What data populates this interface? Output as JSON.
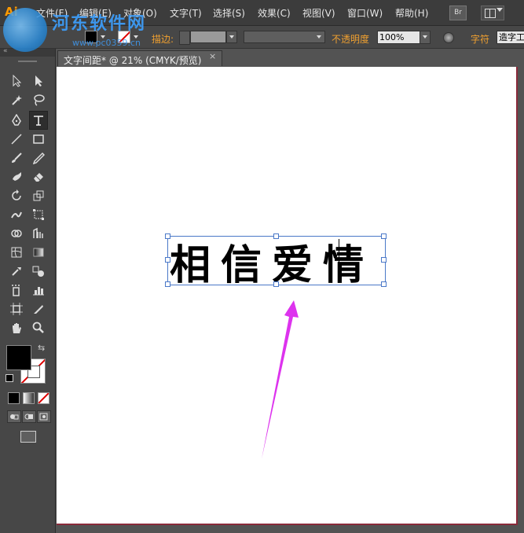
{
  "app": {
    "logo_text": "Ai",
    "watermark_text": "河东软件网",
    "watermark_url": "www.pc0359.cn"
  },
  "menu": {
    "items": [
      "文件(F)",
      "编辑(E)",
      "对象(O)",
      "文字(T)",
      "选择(S)",
      "效果(C)",
      "视图(V)",
      "窗口(W)",
      "帮助(H)"
    ],
    "bridge_label": "Br"
  },
  "control_bar": {
    "fill_color": "#000000",
    "stroke_label": "描边:",
    "opacity_label": "不透明度",
    "opacity_value": "100%",
    "char_label": "字符",
    "font_value": "造字工"
  },
  "document": {
    "tab_title": "文字间距* @ 21% (CMYK/预览)",
    "close_glyph": "×",
    "text": "相信爱情",
    "arrow_color": "#dd33ee"
  },
  "tools": {
    "collapse_glyph": "«",
    "swap_glyph": "⇆"
  }
}
